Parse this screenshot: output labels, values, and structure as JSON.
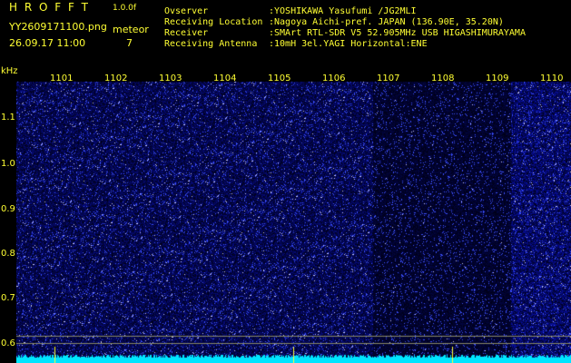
{
  "header": {
    "program": "H R O F F T",
    "version": "1.0.0f",
    "filename": "YY2609171100.png",
    "datetime": "26.09.17 11:00",
    "mode_label": "meteor",
    "count": "7"
  },
  "info": {
    "labels": [
      "Ovserver",
      "Receiving Location",
      "Receiver",
      "Receiving Antenna"
    ],
    "values": [
      ":YOSHIKAWA Yasufumi /JG2MLI",
      ":Nagoya Aichi-pref. JAPAN (136.90E, 35.20N)",
      ":SMArt RTL-SDR V5 52.905MHz USB HIGASHIMURAYAMA",
      ":10mH 3el.YAGI Horizontal:ENE"
    ]
  },
  "axis": {
    "y_unit": "kHz",
    "y_ticks": [
      "1.1",
      "1.0",
      "0.9",
      "0.8",
      "0.7",
      "0.6"
    ],
    "x_ticks": [
      "1101",
      "1102",
      "1103",
      "1104",
      "1105",
      "1106",
      "1107",
      "1108",
      "1109",
      "1110"
    ]
  },
  "colors": {
    "background": "#000000",
    "label": "#ffff33",
    "noise": "#2a37c8",
    "baseline": "#00e5ff"
  }
}
